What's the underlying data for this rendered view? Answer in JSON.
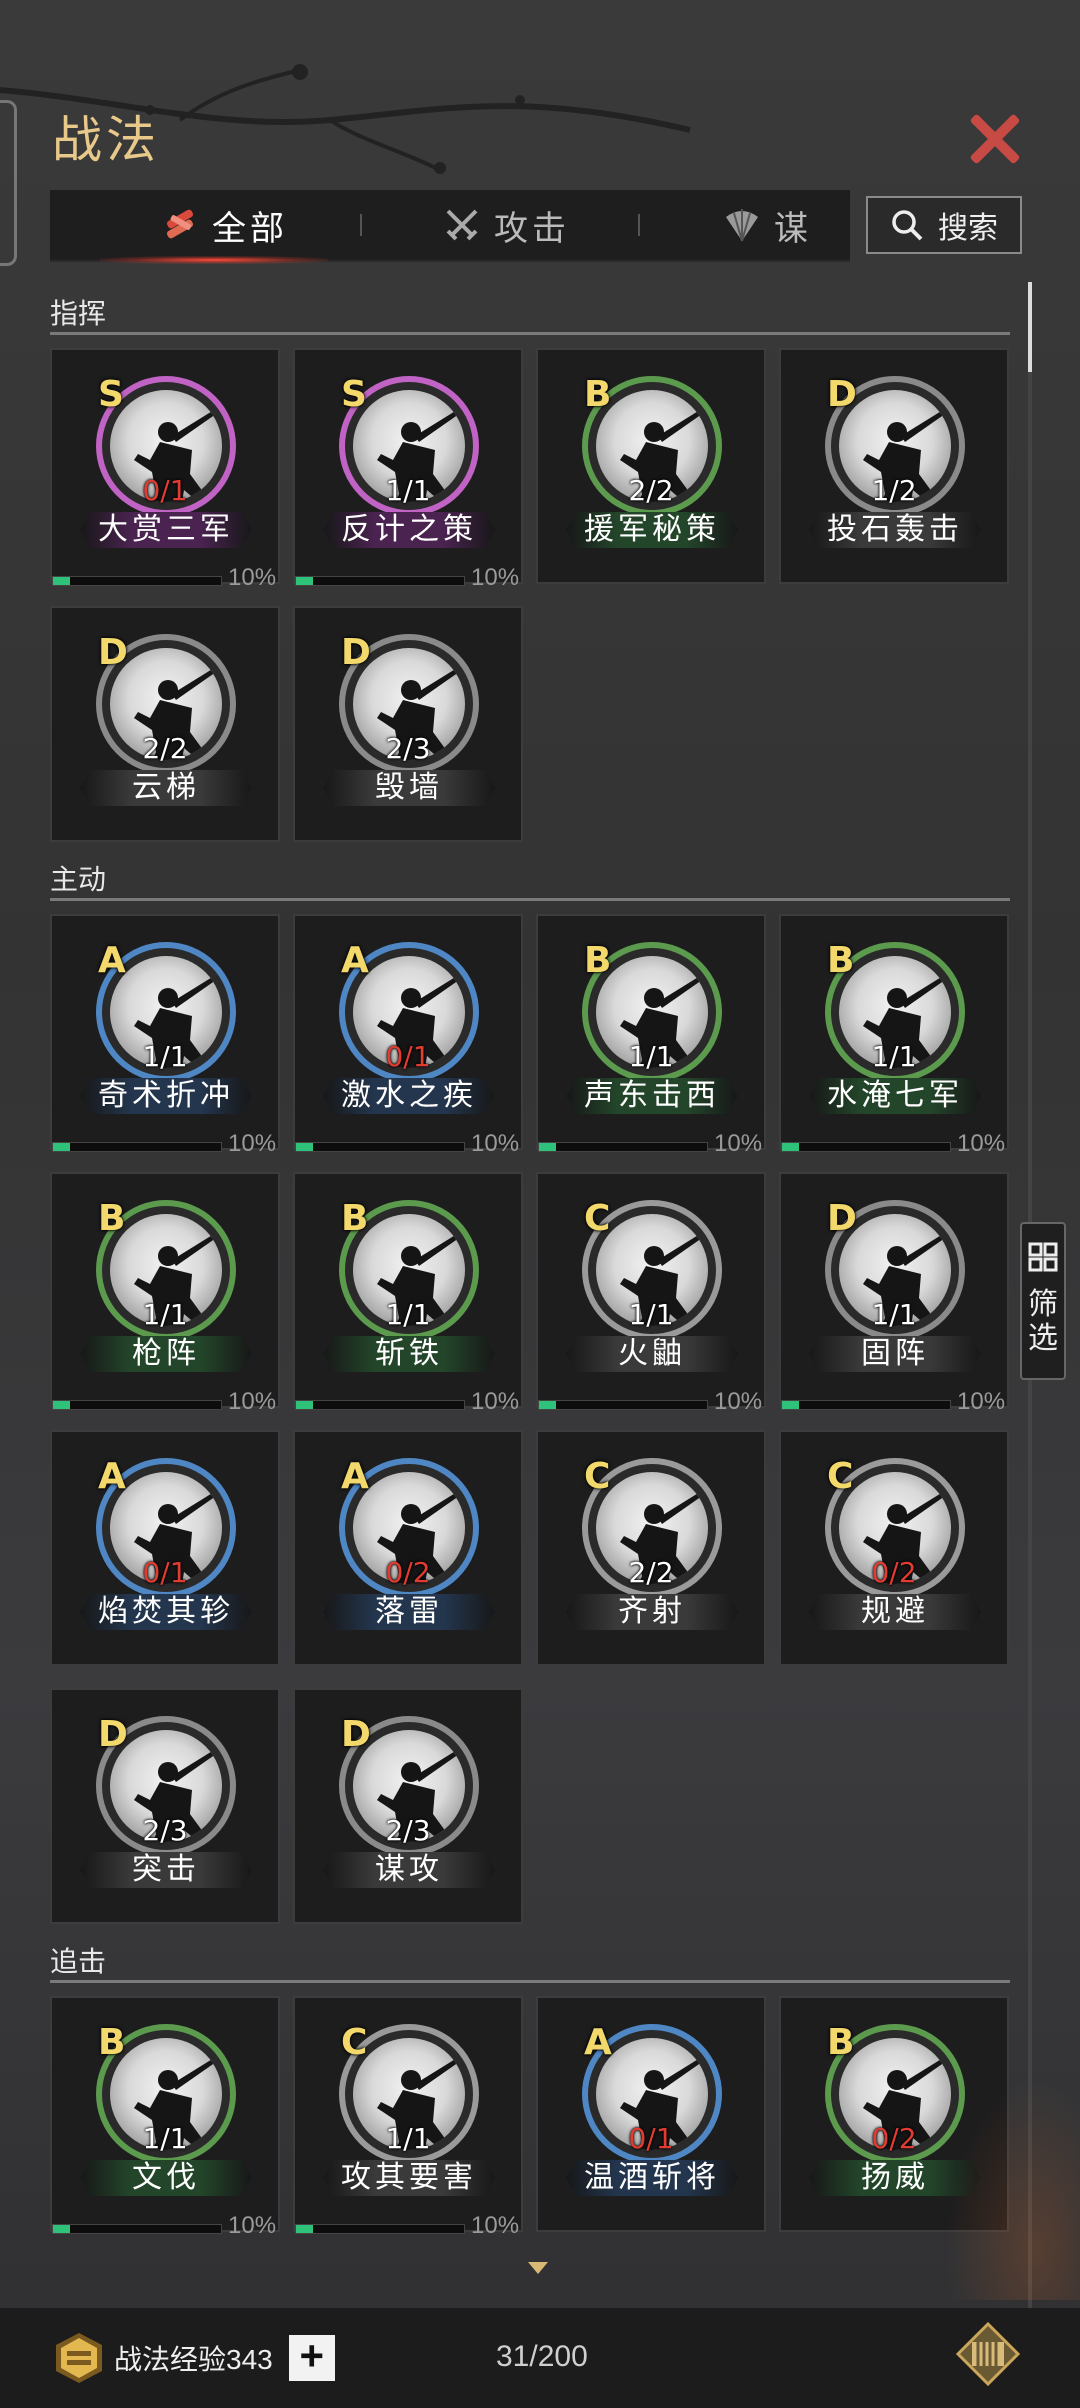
{
  "header": {
    "title": "战法",
    "close_icon": "close-icon"
  },
  "tabs": [
    {
      "label": "全部",
      "icon": "scroll-bundle-icon",
      "active": true
    },
    {
      "label": "攻击",
      "icon": "crossed-swords-icon",
      "active": false
    },
    {
      "label": "谋",
      "icon": "fan-icon",
      "active": false
    }
  ],
  "search": {
    "label": "搜索",
    "icon": "search-icon"
  },
  "filter": {
    "label": "筛选",
    "icon": "grid-icon"
  },
  "sections": [
    {
      "title": "指挥",
      "cards": [
        {
          "grade": "S",
          "count": "0/1",
          "count_red": true,
          "name": "大赏三军",
          "ring": "#c063c4",
          "banner": "#4a2350",
          "progress": 0.1,
          "pct": "10%"
        },
        {
          "grade": "S",
          "count": "1/1",
          "count_red": false,
          "name": "反计之策",
          "ring": "#c063c4",
          "banner": "#4a2350",
          "progress": 0.1,
          "pct": "10%"
        },
        {
          "grade": "B",
          "count": "2/2",
          "count_red": false,
          "name": "援军秘策",
          "ring": "#5c9a4e",
          "banner": "#23462a",
          "progress": null,
          "pct": ""
        },
        {
          "grade": "D",
          "count": "1/2",
          "count_red": false,
          "name": "投石轰击",
          "ring": "#8a8a8a",
          "banner": "#3a3a3a",
          "progress": null,
          "pct": ""
        },
        {
          "grade": "D",
          "count": "2/2",
          "count_red": false,
          "name": "云梯",
          "ring": "#8a8a8a",
          "banner": "#3a3a3a",
          "progress": null,
          "pct": ""
        },
        {
          "grade": "D",
          "count": "2/3",
          "count_red": false,
          "name": "毁墙",
          "ring": "#8a8a8a",
          "banner": "#3a3a3a",
          "progress": null,
          "pct": ""
        }
      ]
    },
    {
      "title": "主动",
      "cards": [
        {
          "grade": "A",
          "count": "1/1",
          "count_red": false,
          "name": "奇术折冲",
          "ring": "#4f86c4",
          "banner": "#23364e",
          "progress": 0.1,
          "pct": "10%"
        },
        {
          "grade": "A",
          "count": "0/1",
          "count_red": true,
          "name": "激水之疾",
          "ring": "#4f86c4",
          "banner": "#23364e",
          "progress": 0.1,
          "pct": "10%"
        },
        {
          "grade": "B",
          "count": "1/1",
          "count_red": false,
          "name": "声东击西",
          "ring": "#5c9a4e",
          "banner": "#23462a",
          "progress": 0.1,
          "pct": "10%"
        },
        {
          "grade": "B",
          "count": "1/1",
          "count_red": false,
          "name": "水淹七军",
          "ring": "#5c9a4e",
          "banner": "#23462a",
          "progress": 0.1,
          "pct": "10%"
        },
        {
          "grade": "B",
          "count": "1/1",
          "count_red": false,
          "name": "枪阵",
          "ring": "#5c9a4e",
          "banner": "#23462a",
          "progress": 0.1,
          "pct": "10%"
        },
        {
          "grade": "B",
          "count": "1/1",
          "count_red": false,
          "name": "斩铁",
          "ring": "#5c9a4e",
          "banner": "#23462a",
          "progress": 0.1,
          "pct": "10%"
        },
        {
          "grade": "C",
          "count": "1/1",
          "count_red": false,
          "name": "火鼬",
          "ring": "#9a9a9a",
          "banner": "#3a3a3a",
          "progress": 0.1,
          "pct": "10%"
        },
        {
          "grade": "D",
          "count": "1/1",
          "count_red": false,
          "name": "固阵",
          "ring": "#8a8a8a",
          "banner": "#3a3a3a",
          "progress": 0.1,
          "pct": "10%"
        },
        {
          "grade": "A",
          "count": "0/1",
          "count_red": true,
          "name": "焰焚其轸",
          "ring": "#4f86c4",
          "banner": "#23364e",
          "progress": null,
          "pct": ""
        },
        {
          "grade": "A",
          "count": "0/2",
          "count_red": true,
          "name": "落雷",
          "ring": "#4f86c4",
          "banner": "#23364e",
          "progress": null,
          "pct": ""
        },
        {
          "grade": "C",
          "count": "2/2",
          "count_red": false,
          "name": "齐射",
          "ring": "#9a9a9a",
          "banner": "#3a3a3a",
          "progress": null,
          "pct": ""
        },
        {
          "grade": "C",
          "count": "0/2",
          "count_red": true,
          "name": "规避",
          "ring": "#9a9a9a",
          "banner": "#3a3a3a",
          "progress": null,
          "pct": ""
        },
        {
          "grade": "D",
          "count": "2/3",
          "count_red": false,
          "name": "突击",
          "ring": "#8a8a8a",
          "banner": "#3a3a3a",
          "progress": null,
          "pct": ""
        },
        {
          "grade": "D",
          "count": "2/3",
          "count_red": false,
          "name": "谋攻",
          "ring": "#8a8a8a",
          "banner": "#3a3a3a",
          "progress": null,
          "pct": ""
        }
      ]
    },
    {
      "title": "追击",
      "cards": [
        {
          "grade": "B",
          "count": "1/1",
          "count_red": false,
          "name": "文伐",
          "ring": "#5c9a4e",
          "banner": "#23462a",
          "progress": 0.1,
          "pct": "10%"
        },
        {
          "grade": "C",
          "count": "1/1",
          "count_red": false,
          "name": "攻其要害",
          "ring": "#9a9a9a",
          "banner": "#3a3a3a",
          "progress": 0.1,
          "pct": "10%"
        },
        {
          "grade": "A",
          "count": "0/1",
          "count_red": true,
          "name": "温酒斩将",
          "ring": "#4f86c4",
          "banner": "#23364e",
          "progress": null,
          "pct": ""
        },
        {
          "grade": "B",
          "count": "0/2",
          "count_red": true,
          "name": "扬威",
          "ring": "#5c9a4e",
          "banner": "#23462a",
          "progress": null,
          "pct": ""
        }
      ]
    }
  ],
  "footer": {
    "exp_label": "战法经验343",
    "exp_icon": "exp-scroll-icon",
    "plus_label": "+",
    "capacity": "31/200",
    "bag_icon": "scroll-storage-icon"
  },
  "colors": {
    "title": "#e9c98a",
    "close": "#c84a44",
    "grade": "#f3d86b",
    "progress": "#2fc27a",
    "red_count": "#e23b32"
  }
}
